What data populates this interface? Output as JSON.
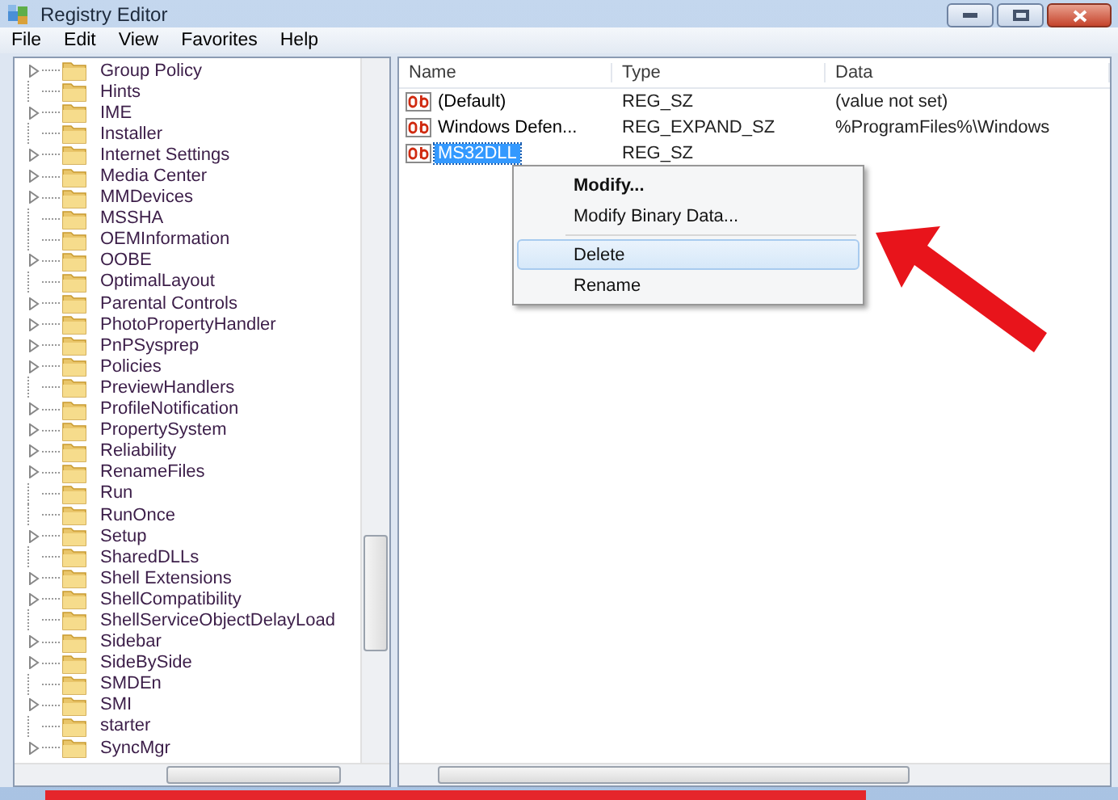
{
  "window": {
    "title": "Registry Editor"
  },
  "menu": [
    "File",
    "Edit",
    "View",
    "Favorites",
    "Help"
  ],
  "tree": {
    "items": [
      {
        "label": "Group Policy",
        "expandable": true
      },
      {
        "label": "Hints",
        "expandable": false
      },
      {
        "label": "IME",
        "expandable": true
      },
      {
        "label": "Installer",
        "expandable": false
      },
      {
        "label": "Internet Settings",
        "expandable": true
      },
      {
        "label": "Media Center",
        "expandable": true
      },
      {
        "label": "MMDevices",
        "expandable": true
      },
      {
        "label": "MSSHA",
        "expandable": false
      },
      {
        "label": "OEMInformation",
        "expandable": false
      },
      {
        "label": "OOBE",
        "expandable": true
      },
      {
        "label": "OptimalLayout",
        "expandable": false
      },
      {
        "label": "Parental Controls",
        "expandable": true
      },
      {
        "label": "PhotoPropertyHandler",
        "expandable": true
      },
      {
        "label": "PnPSysprep",
        "expandable": true
      },
      {
        "label": "Policies",
        "expandable": true
      },
      {
        "label": "PreviewHandlers",
        "expandable": false
      },
      {
        "label": "ProfileNotification",
        "expandable": true
      },
      {
        "label": "PropertySystem",
        "expandable": true
      },
      {
        "label": "Reliability",
        "expandable": true
      },
      {
        "label": "RenameFiles",
        "expandable": true
      },
      {
        "label": "Run",
        "expandable": false
      },
      {
        "label": "RunOnce",
        "expandable": false
      },
      {
        "label": "Setup",
        "expandable": true
      },
      {
        "label": "SharedDLLs",
        "expandable": false
      },
      {
        "label": "Shell Extensions",
        "expandable": true
      },
      {
        "label": "ShellCompatibility",
        "expandable": true
      },
      {
        "label": "ShellServiceObjectDelayLoad",
        "expandable": false
      },
      {
        "label": "Sidebar",
        "expandable": true
      },
      {
        "label": "SideBySide",
        "expandable": true
      },
      {
        "label": "SMDEn",
        "expandable": false
      },
      {
        "label": "SMI",
        "expandable": true
      },
      {
        "label": "starter",
        "expandable": false
      },
      {
        "label": "SyncMgr",
        "expandable": true
      }
    ]
  },
  "values": {
    "columns": [
      "Name",
      "Type",
      "Data"
    ],
    "rows": [
      {
        "name": "(Default)",
        "type": "REG_SZ",
        "data": "(value not set)",
        "selected": false
      },
      {
        "name": "Windows Defen...",
        "type": "REG_EXPAND_SZ",
        "data": "%ProgramFiles%\\Windows",
        "selected": false
      },
      {
        "name": "MS32DLL",
        "type": "REG_SZ",
        "selected": true
      }
    ]
  },
  "context_menu": {
    "items": [
      {
        "kind": "item",
        "label": "Modify...",
        "default": true,
        "selected": false
      },
      {
        "kind": "item",
        "label": "Modify Binary Data...",
        "default": false,
        "selected": false
      },
      {
        "kind": "separator"
      },
      {
        "kind": "item",
        "label": "Delete",
        "default": false,
        "selected": true
      },
      {
        "kind": "item",
        "label": "Rename",
        "default": false,
        "selected": false
      }
    ]
  }
}
